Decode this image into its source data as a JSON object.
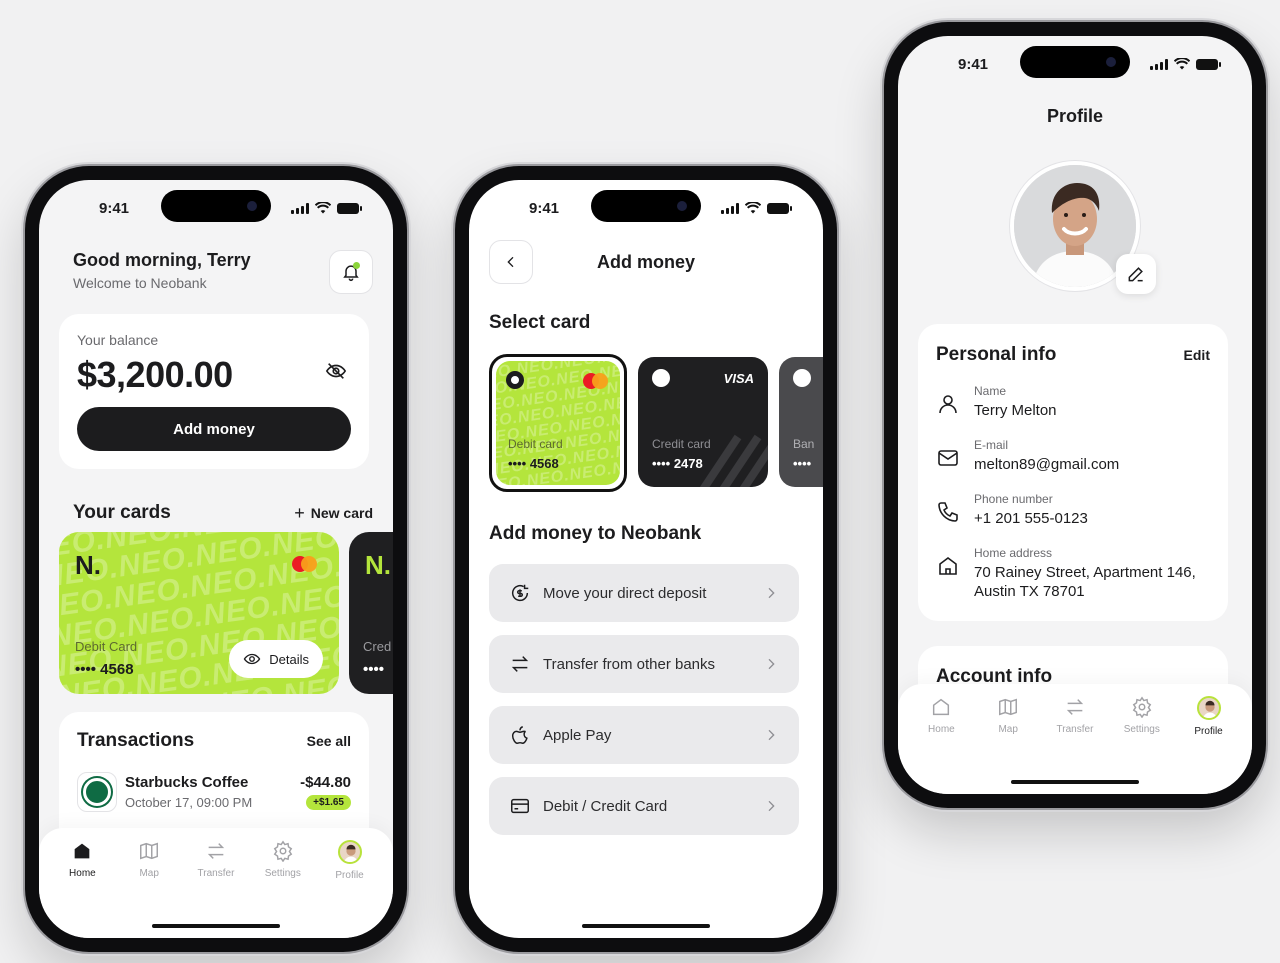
{
  "status_time": "9:41",
  "colors": {
    "accent": "#b4e53c",
    "dark": "#1c1c1e",
    "bg": "#f4f4f5"
  },
  "tabbar": {
    "items": [
      {
        "label": "Home",
        "icon": "home-icon"
      },
      {
        "label": "Map",
        "icon": "map-icon"
      },
      {
        "label": "Transfer",
        "icon": "transfer-icon"
      },
      {
        "label": "Settings",
        "icon": "gear-icon"
      },
      {
        "label": "Profile",
        "icon": "avatar"
      }
    ]
  },
  "home": {
    "greeting": "Good morning, Terry",
    "subtitle": "Welcome to Neobank",
    "balance_label": "Your balance",
    "balance_value": "$3,200.00",
    "add_money_label": "Add money",
    "cards_title": "Your cards",
    "new_card_label": "New card",
    "card_logo": "N.",
    "card_type": "Debit Card",
    "card_number": "•••• 4568",
    "details_label": "Details",
    "second_card_logo": "N.",
    "second_card_type": "Cred",
    "second_card_number": "••••",
    "transactions_title": "Transactions",
    "see_all_label": "See all",
    "transaction": {
      "merchant": "Starbucks Coffee",
      "date": "October 17, 09:00 PM",
      "amount": "-$44.80",
      "cashback": "+$1.65"
    },
    "active_tab": "Home"
  },
  "add_money": {
    "title": "Add money",
    "select_card_title": "Select card",
    "cards": [
      {
        "type": "Debit card",
        "number": "•••• 4568"
      },
      {
        "type": "Credit card",
        "number": "•••• 2478",
        "brand": "VISA"
      },
      {
        "type": "Ban",
        "number": "••••"
      }
    ],
    "section_title": "Add money to Neobank",
    "options": [
      {
        "label": "Move your direct deposit",
        "icon": "deposit-icon"
      },
      {
        "label": "Transfer from other banks",
        "icon": "transfer-icon"
      },
      {
        "label": "Apple Pay",
        "icon": "apple-icon"
      },
      {
        "label": "Debit / Credit Card",
        "icon": "card-icon"
      }
    ]
  },
  "profile": {
    "title": "Profile",
    "personal_info_title": "Personal info",
    "edit_label": "Edit",
    "fields": [
      {
        "label": "Name",
        "value": "Terry Melton",
        "icon": "user-icon"
      },
      {
        "label": "E-mail",
        "value": "melton89@gmail.com",
        "icon": "mail-icon"
      },
      {
        "label": "Phone number",
        "value": "+1 201 555-0123",
        "icon": "phone-icon"
      },
      {
        "label": "Home address",
        "value": "70 Rainey Street, Apartment 146, Austin TX 78701",
        "icon": "home-icon"
      }
    ],
    "account_info_title": "Account info",
    "active_tab": "Profile"
  }
}
